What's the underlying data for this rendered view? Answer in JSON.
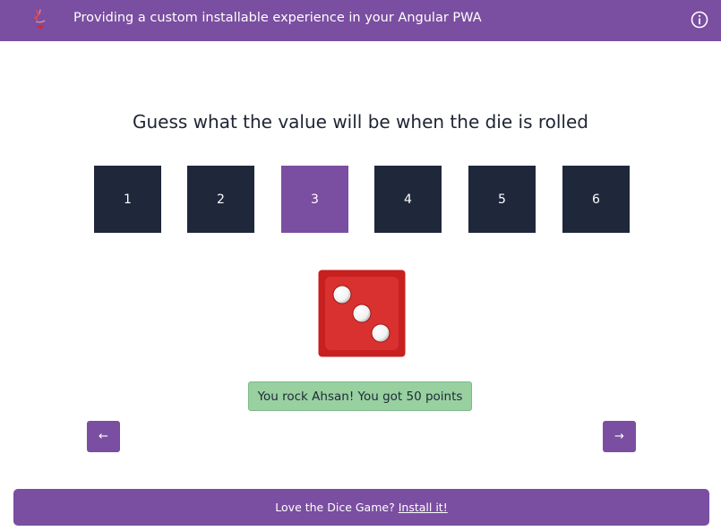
{
  "header": {
    "title": "Providing a custom installable experience in your Angular PWA",
    "logo_icon": "angular-pwa-logo",
    "info_icon": "info-icon",
    "background": "#7a4ea0"
  },
  "game": {
    "prompt": "Guess what the value will be when the die is rolled",
    "options": [
      "1",
      "2",
      "3",
      "4",
      "5",
      "6"
    ],
    "selected": "3",
    "die_value": 3,
    "die_color": "#d62b2b",
    "result_message": "You rock Ahsan! You got 50 points",
    "result_color": "#98d0a0"
  },
  "nav": {
    "prev_icon": "←",
    "next_icon": "→"
  },
  "install": {
    "message": "Love the Dice Game?",
    "link_label": "Install it!"
  },
  "colors": {
    "accent": "#7a4ea0",
    "tile": "#1f273b"
  }
}
